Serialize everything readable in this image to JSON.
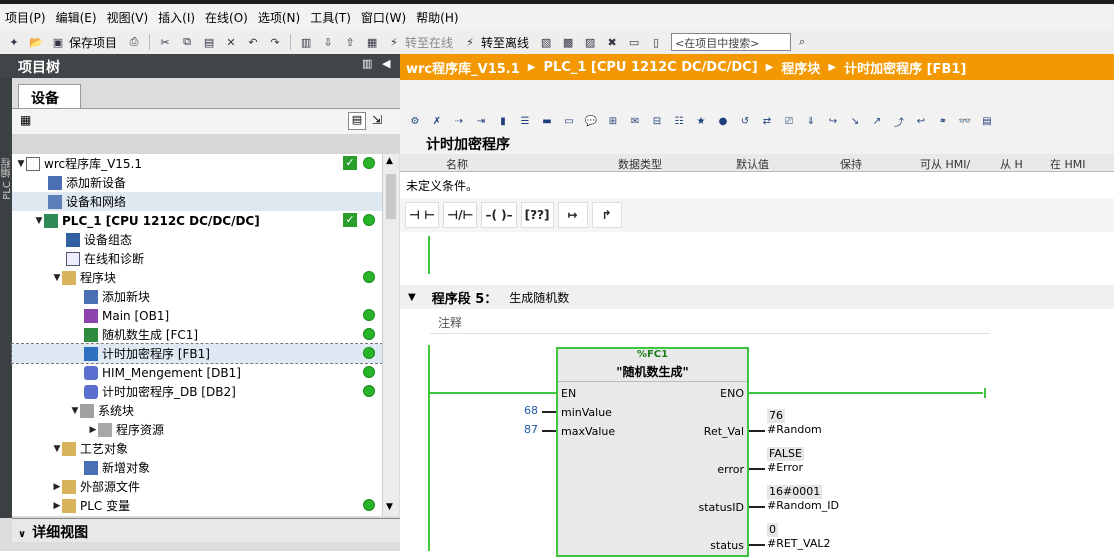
{
  "menu": [
    "项目(P)",
    "编辑(E)",
    "视图(V)",
    "插入(I)",
    "在线(O)",
    "选项(N)",
    "工具(T)",
    "窗口(W)",
    "帮助(H)"
  ],
  "toolbar": {
    "save_project": "保存项目",
    "go_online": "转至在线",
    "go_offline": "转至离线",
    "search_placeholder": "<在项目中搜索>"
  },
  "project_tree": {
    "title": "项目树",
    "side_tab": "PLC 编程",
    "device_tab": "设备",
    "items": [
      {
        "label": "wrc程序库_V15.1",
        "check": true,
        "dot": true
      },
      {
        "label": "添加新设备"
      },
      {
        "label": "设备和网络"
      },
      {
        "label": "PLC_1 [CPU 1212C DC/DC/DC]",
        "check": true,
        "dot": true
      },
      {
        "label": "设备组态"
      },
      {
        "label": "在线和诊断"
      },
      {
        "label": "程序块",
        "dot": true
      },
      {
        "label": "添加新块"
      },
      {
        "label": "Main [OB1]",
        "dot": true
      },
      {
        "label": "随机数生成 [FC1]",
        "dot": true
      },
      {
        "label": "计时加密程序 [FB1]",
        "dot": true
      },
      {
        "label": "HIM_Mengement [DB1]",
        "dot": true
      },
      {
        "label": "计时加密程序_DB [DB2]",
        "dot": true
      },
      {
        "label": "系统块"
      },
      {
        "label": "程序资源"
      },
      {
        "label": "工艺对象"
      },
      {
        "label": "新增对象"
      },
      {
        "label": "外部源文件"
      },
      {
        "label": "PLC 变量",
        "dot": true
      }
    ],
    "detail_view": "详细视图"
  },
  "breadcrumb": [
    "wrc程序库_V15.1",
    "PLC_1 [CPU 1212C DC/DC/DC]",
    "程序块",
    "计时加密程序 [FB1]"
  ],
  "editor": {
    "block_title": "计时加密程序",
    "interface_columns": [
      "名称",
      "数据类型",
      "默认值",
      "保持",
      "可从 HMI/",
      "从 H",
      "在 HMI"
    ],
    "undefined_conditions": "未定义条件。",
    "ladder_tools": [
      "⊣ ⊢",
      "⊣/⊢",
      "–( )–",
      "[??]",
      "↦",
      "↱"
    ],
    "network": {
      "label": "程序段 5：",
      "title": "生成随机数",
      "comment": "注释"
    },
    "block": {
      "instance": "%FC1",
      "name": "\"随机数生成\"",
      "pins_left": [
        "EN",
        "minValue",
        "maxValue"
      ],
      "pins_right": [
        "ENO",
        "Ret_Val",
        "error",
        "statusID",
        "status"
      ],
      "input_values": {
        "minValue": "68",
        "maxValue": "87"
      },
      "outputs": [
        {
          "value": "76",
          "tag": "#Random"
        },
        {
          "value": "FALSE",
          "tag": "#Error"
        },
        {
          "value": "16#0001",
          "tag": "#Random_ID"
        },
        {
          "value": "0",
          "tag": "#RET_VAL2"
        }
      ]
    }
  }
}
